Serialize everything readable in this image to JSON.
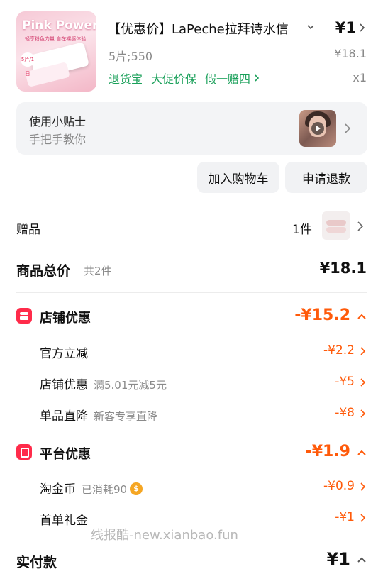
{
  "product": {
    "image_brand": "Pink Power",
    "image_tagline": "轻享粉色力量 自在裸感体验",
    "image_badge": "5片/1日",
    "title": "【优惠价】LaPeche拉拜诗水信",
    "price": "¥1",
    "spec": "5片;550",
    "original_price": "¥18.1",
    "services": [
      "退货宝",
      "大促价保",
      "假一赔四"
    ],
    "quantity": "x1"
  },
  "tips": {
    "title": "使用小贴士",
    "subtitle": "手把手教你"
  },
  "buttons": {
    "add_to_cart": "加入购物车",
    "request_refund": "申请退款"
  },
  "gift": {
    "label": "赠品",
    "count": "1件"
  },
  "summary": {
    "total_label": "商品总价",
    "total_count": "共2件",
    "total_value": "¥18.1"
  },
  "shop_discount": {
    "title": "店铺优惠",
    "total": "-¥15.2",
    "rows": [
      {
        "label": "官方立减",
        "note": "",
        "value": "-¥2.2"
      },
      {
        "label": "店铺优惠",
        "note": "满5.01元减5元",
        "value": "-¥5"
      },
      {
        "label": "单品直降",
        "note": "新客专享直降",
        "value": "-¥8"
      }
    ]
  },
  "platform_discount": {
    "title": "平台优惠",
    "total": "-¥1.9",
    "rows": [
      {
        "label": "淘金币",
        "note": "已消耗90",
        "value": "-¥0.9"
      },
      {
        "label": "首单礼金",
        "note": "",
        "value": "-¥1"
      }
    ]
  },
  "watermark": "线报酷-new.xianbao.fun",
  "payment": {
    "label": "实付款",
    "value": "¥1"
  },
  "colors": {
    "discount": "#ff5a0a",
    "service_green": "#1aa05a",
    "badge_red": "#ff2b4a"
  }
}
